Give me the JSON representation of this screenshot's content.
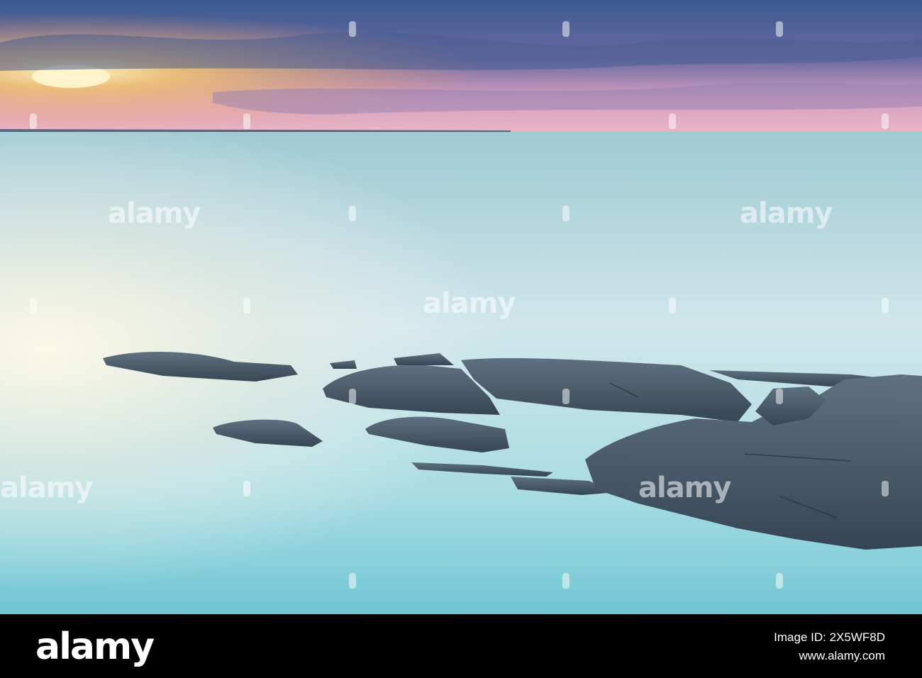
{
  "photo": {
    "description_icon": "sunset-seascape-photo",
    "colors": {
      "sky_top": "#3b5a8f",
      "sky_glow": "#f3c77a",
      "horizon_pink": "#d79bbd",
      "water": "#bfe0e6",
      "water_deep": "#7ccbd6",
      "rock": "#3d4e60"
    }
  },
  "watermark": {
    "text": "alamy"
  },
  "footer": {
    "logo": "alamy",
    "image_id_label": "Image ID: 2X5WF8D",
    "site": "www.alamy.com"
  }
}
